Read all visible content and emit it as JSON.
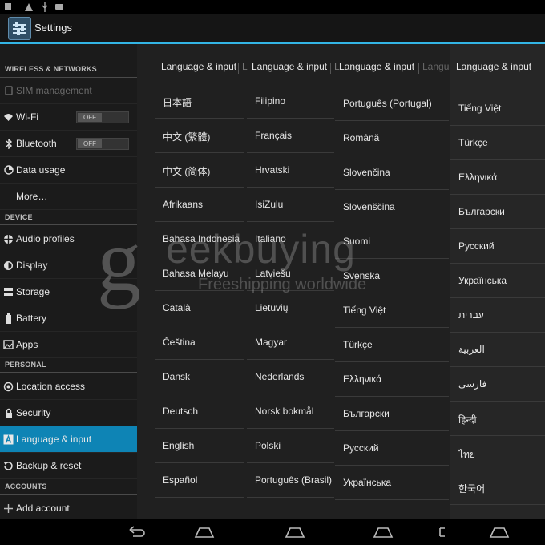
{
  "status_bar": {
    "icons": [
      "warning-icon",
      "usb-icon",
      "sdcard-icon"
    ]
  },
  "action_bar": {
    "title": "Settings",
    "icon": "settings-icon",
    "accent": "#33b5e5"
  },
  "sidebar": {
    "sections": {
      "wireless": "WIRELESS & NETWORKS",
      "device": "DEVICE",
      "personal": "PERSONAL",
      "accounts": "ACCOUNTS"
    },
    "items": [
      {
        "label": "SIM management",
        "icon": "sim-icon"
      },
      {
        "label": "Wi-Fi",
        "icon": "wifi-icon",
        "toggle": "OFF"
      },
      {
        "label": "Bluetooth",
        "icon": "bluetooth-icon",
        "toggle": "OFF"
      },
      {
        "label": "Data usage",
        "icon": "data-usage-icon"
      },
      {
        "label": "More…",
        "icon": ""
      },
      {
        "label": "Audio profiles",
        "icon": "audio-profiles-icon"
      },
      {
        "label": "Display",
        "icon": "display-icon"
      },
      {
        "label": "Storage",
        "icon": "storage-icon"
      },
      {
        "label": "Battery",
        "icon": "battery-icon"
      },
      {
        "label": "Apps",
        "icon": "apps-icon"
      },
      {
        "label": "Location access",
        "icon": "location-icon"
      },
      {
        "label": "Security",
        "icon": "lock-icon"
      },
      {
        "label": "Language & input",
        "icon": "keyboard-a-icon",
        "selected": true
      },
      {
        "label": "Backup & reset",
        "icon": "backup-icon"
      },
      {
        "label": "Add account",
        "icon": "plus-icon"
      }
    ],
    "selected_color": "#0e84b5"
  },
  "panels": [
    {
      "title": "Language & input",
      "title_peek": "L",
      "items": [
        "日本語",
        "中文 (繁體)",
        "中文 (简体)",
        "Afrikaans",
        "Bahasa Indonesia",
        "Bahasa Melayu",
        "Català",
        "Čeština",
        "Dansk",
        "Deutsch",
        "English",
        "Español"
      ]
    },
    {
      "title": "Language & input",
      "title_peek": "L",
      "items": [
        "Filipino",
        "Français",
        "Hrvatski",
        "IsiZulu",
        "Italiano",
        "Latviešu",
        "Lietuvių",
        "Magyar",
        "Nederlands",
        "Norsk bokmål",
        "Polski",
        "Português (Brasil)"
      ]
    },
    {
      "title": "Language & input",
      "title_peek": "Langu",
      "items": [
        "Português (Portugal)",
        "Română",
        "Slovenčina",
        "Slovenščina",
        "Suomi",
        "Svenska",
        "Tiếng Việt",
        "Türkçe",
        "Ελληνικά",
        "Български",
        "Русский",
        "Українська"
      ]
    },
    {
      "title": "Language & input",
      "items": [
        "Tiếng Việt",
        "Türkçe",
        "Ελληνικά",
        "Български",
        "Русский",
        "Українська",
        "עברית",
        "العربية",
        "فارسی",
        "हिन्दी",
        "ไทย",
        "한국어"
      ]
    }
  ],
  "watermark": {
    "brand_letter": "g",
    "brand_rest": "eekbuying",
    "tagline": "Freeshipping worldwide"
  },
  "nav_bar": {
    "icons": [
      "back-icon",
      "home-icon",
      "recents-icon"
    ]
  }
}
